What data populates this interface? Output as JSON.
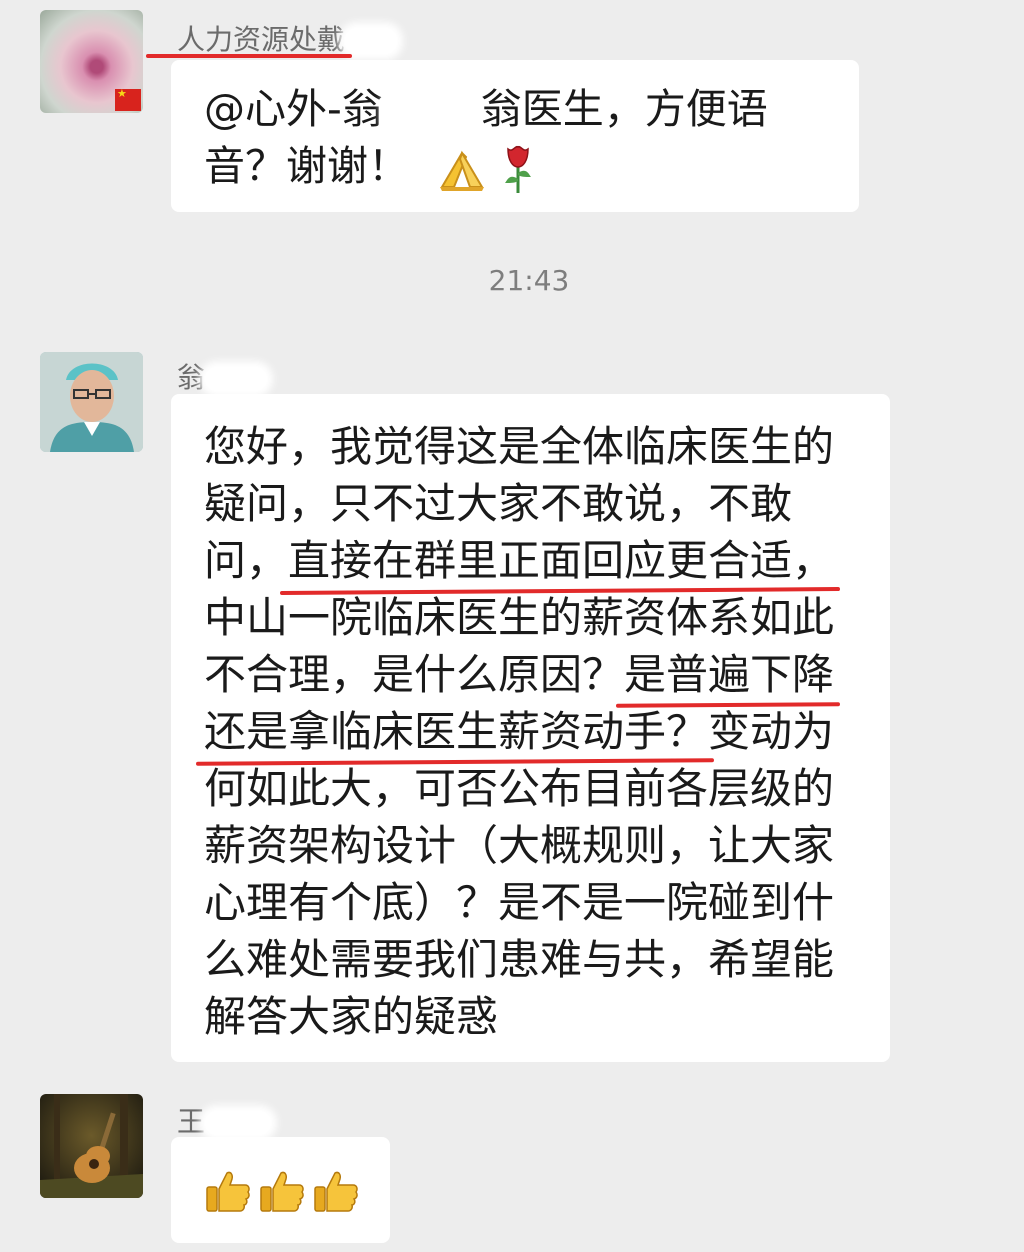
{
  "colors": {
    "background": "#ededed",
    "bubble": "#ffffff",
    "underline": "#e22a2a",
    "meta_text": "#7e7e7e"
  },
  "messages": [
    {
      "sender": "人力资源处戴",
      "avatar": "flower-avatar",
      "lines": [
        "@心外-翁",
        "翁医生，方便语",
        "音？谢谢！"
      ],
      "emoji": [
        "pray-emoji",
        "rose-emoji"
      ]
    },
    {
      "timestamp": "21:43"
    },
    {
      "sender": "翁",
      "avatar": "doctor-avatar",
      "lines": [
        {
          "pre": "您好，我觉得这是全体临床医生的"
        },
        {
          "pre": "疑问，只不过大家不敢说，不敢"
        },
        {
          "pre": "问，",
          "hl": "直接在群里正面回应更合适，",
          "post": ""
        },
        {
          "pre": "中山一院临床医生的薪资体系如此"
        },
        {
          "pre": "不合理，是什么原因？",
          "hl": "是普遍下降",
          "post": ""
        },
        {
          "pre": "",
          "hl": "还是拿临床医生薪资动手？",
          "post": "变动为"
        },
        {
          "pre": "何如此大，可否公布目前各层级的"
        },
        {
          "pre": "薪资架构设计（大概规则，让大家"
        },
        {
          "pre": "心理有个底）？是不是一院碰到什"
        },
        {
          "pre": "么难处需要我们患难与共，希望能"
        },
        {
          "pre": "解答大家的疑惑"
        }
      ]
    },
    {
      "sender": "王",
      "avatar": "guitar-avatar",
      "emoji": [
        "thumbs-up-emoji",
        "thumbs-up-emoji",
        "thumbs-up-emoji"
      ]
    }
  ]
}
